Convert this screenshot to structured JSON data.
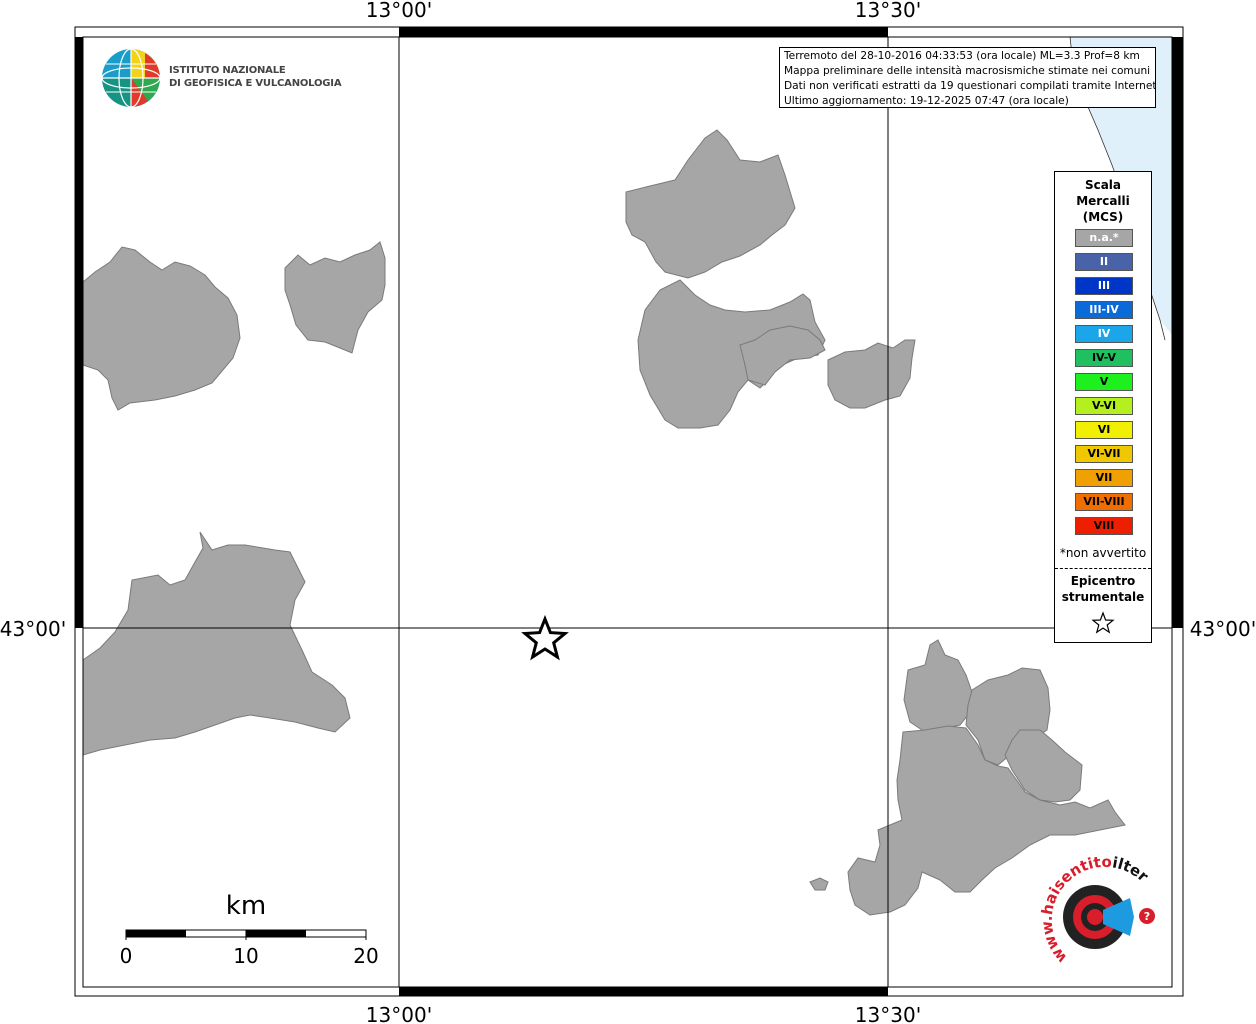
{
  "map": {
    "coordinate_labels": {
      "top_left_lon": "13°00'",
      "top_right_lon": "13°30'",
      "bottom_left_lon": "13°00'",
      "bottom_right_lon": "13°30'",
      "left_lat": "43°00'",
      "right_lat": "43°00'"
    },
    "colors": {
      "municipality_fill": "#a6a6a6",
      "municipality_stroke": "#7a7a7a",
      "sea": "#e0f0fa",
      "frame": "#000000"
    },
    "scale_bar": {
      "unit": "km",
      "labels": [
        "0",
        "10",
        "20"
      ]
    }
  },
  "info_box": {
    "lines": [
      "Terremoto del 28-10-2016 04:33:53 (ora locale) ML=3.3 Prof=8 km",
      "Mappa preliminare delle intensità macrosismiche stimate nei comuni",
      "Dati non verificati estratti da 19 questionari compilati tramite Internet.",
      "Ultimo aggiornamento: 19-12-2025 07:47 (ora locale)"
    ]
  },
  "logo_ingv": {
    "line1": "ISTITUTO NAZIONALE",
    "line2": "DI GEOFISICA E VULCANOLOGIA"
  },
  "logo_haisentito": {
    "text_part1": "www.haisentito",
    "text_part2": "ilterremoto.it"
  },
  "legend": {
    "title": "Scala\nMercalli\n(MCS)",
    "items": [
      {
        "label": "n.a.*",
        "color": "#a6a6a6",
        "text_color": "#ffffff"
      },
      {
        "label": "II",
        "color": "#4a63a8",
        "text_color": "#ffffff"
      },
      {
        "label": "III",
        "color": "#0036c8",
        "text_color": "#ffffff"
      },
      {
        "label": "III-IV",
        "color": "#0a6ad8",
        "text_color": "#ffffff"
      },
      {
        "label": "IV",
        "color": "#1ba6ea",
        "text_color": "#ffffff"
      },
      {
        "label": "IV-V",
        "color": "#20c060",
        "text_color": "#000000"
      },
      {
        "label": "V",
        "color": "#1ef01e",
        "text_color": "#000000"
      },
      {
        "label": "V-VI",
        "color": "#b4f01e",
        "text_color": "#000000"
      },
      {
        "label": "VI",
        "color": "#f0f000",
        "text_color": "#000000"
      },
      {
        "label": "VI-VII",
        "color": "#f0c800",
        "text_color": "#000000"
      },
      {
        "label": "VII",
        "color": "#f0a000",
        "text_color": "#000000"
      },
      {
        "label": "VII-VIII",
        "color": "#f06e00",
        "text_color": "#000000"
      },
      {
        "label": "VIII",
        "color": "#f01e00",
        "text_color": "#000000"
      }
    ],
    "na_note": "*non avvertito",
    "epicenter_label": "Epicentro\nstrumentale"
  }
}
